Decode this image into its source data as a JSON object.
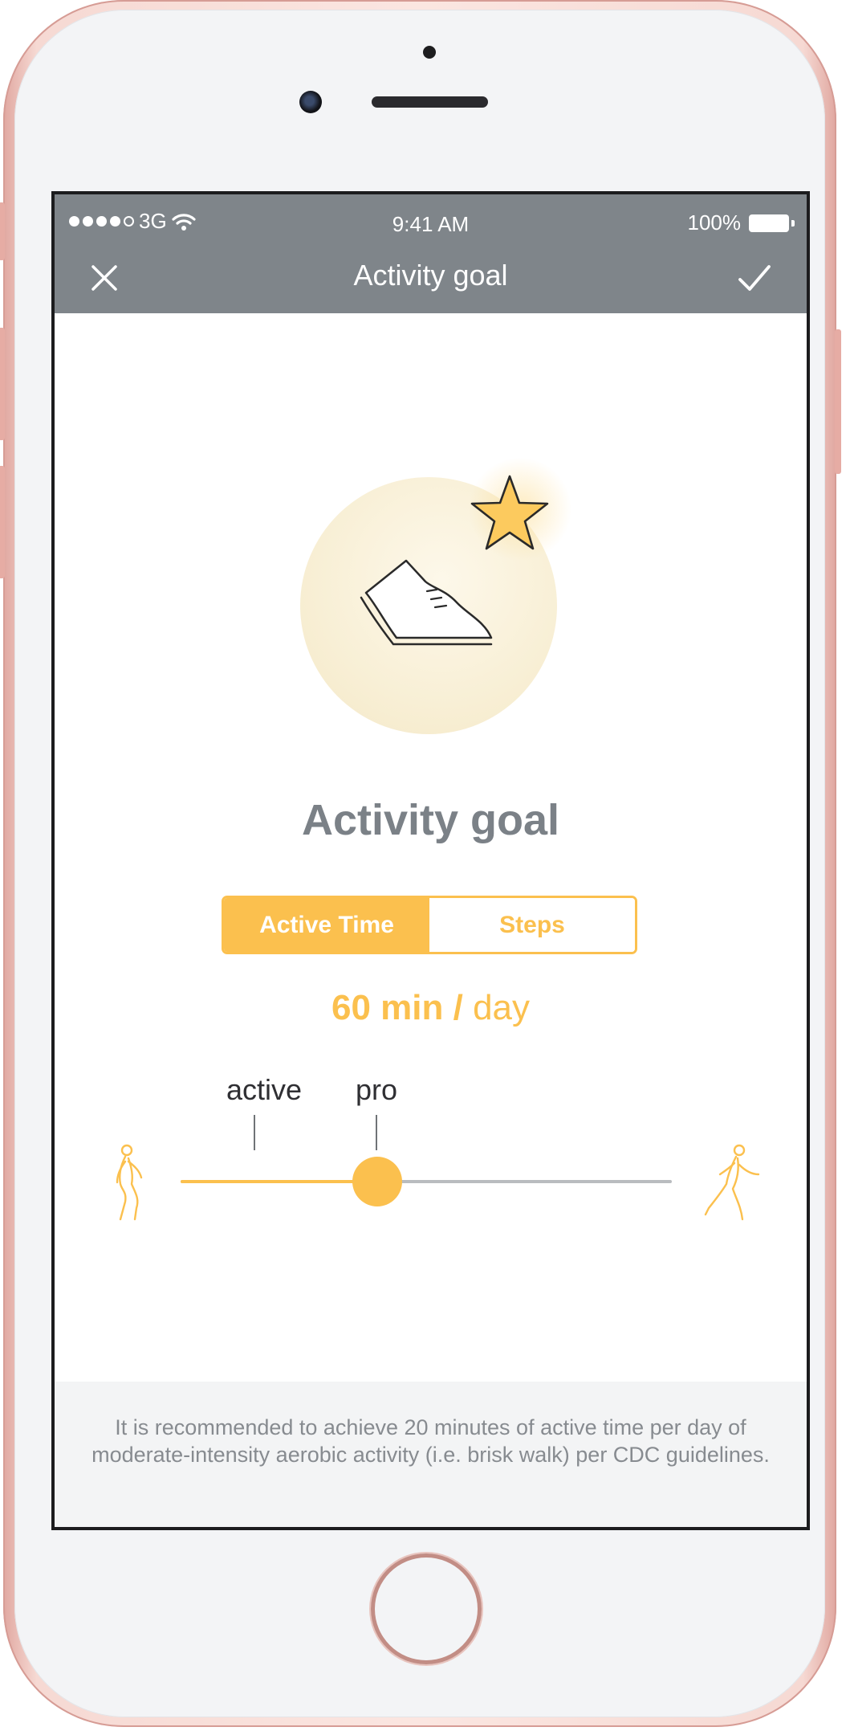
{
  "status_bar": {
    "carrier": "3G",
    "time": "9:41 AM",
    "battery": "100%"
  },
  "nav": {
    "title": "Activity goal",
    "close_icon": "close-icon",
    "done_icon": "checkmark-icon"
  },
  "hero": {
    "icon": "sneaker-icon",
    "badge_icon": "star-icon"
  },
  "main": {
    "title": "Activity goal",
    "tabs": [
      {
        "label": "Active Time",
        "selected": true
      },
      {
        "label": "Steps",
        "selected": false
      }
    ],
    "goal_value": "60 min",
    "goal_separator": "/",
    "goal_unit": "day"
  },
  "slider": {
    "markers": [
      "active",
      "pro"
    ],
    "level": 0.4,
    "left_icon": "walking-person-icon",
    "right_icon": "running-person-icon"
  },
  "footer": {
    "text": "It is recommended to achieve 20 minutes of active time per day of moderate-intensity aerobic activity (i.e. brisk walk) per CDC guidelines."
  },
  "colors": {
    "accent": "#fbc04e",
    "navbar": "#7f858a",
    "title_gray": "#7b8187"
  }
}
